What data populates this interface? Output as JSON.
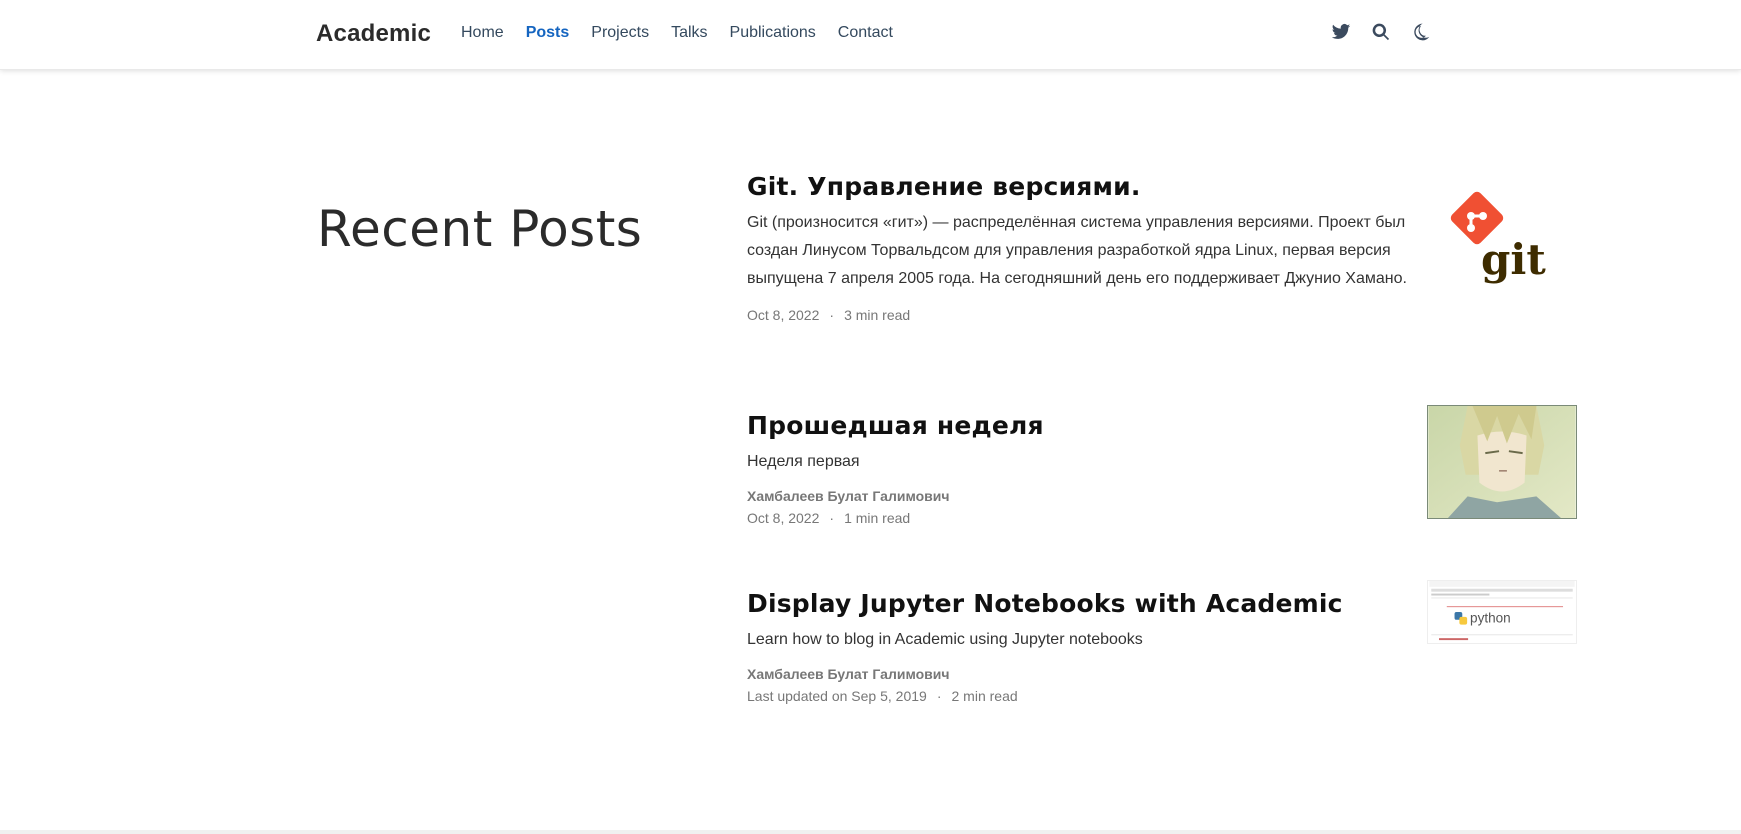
{
  "header": {
    "brand": "Academic",
    "nav": [
      "Home",
      "Posts",
      "Projects",
      "Talks",
      "Publications",
      "Contact"
    ],
    "active": "Posts",
    "icons": [
      "twitter-icon",
      "search-icon",
      "moon-icon"
    ]
  },
  "main": {
    "section_title": "Recent Posts",
    "posts": [
      {
        "title": "Git. Управление версиями.",
        "summary": "Git (произносится «гит») — распределённая система управления версиями. Проект был создан Линусом Торвальдсом для управления разработкой ядра Linux, первая версия выпущена 7 апреля 2005 года. На сегодняшний день его поддерживает Джунио Хамано.",
        "author": "",
        "date": "Oct 8, 2022",
        "read_time": "3 min read",
        "thumb_text": "git"
      },
      {
        "title": "Прошедшая неделя",
        "summary": "Неделя первая",
        "author": "Хамбалеев Булат Галимович",
        "date": "Oct 8, 2022",
        "read_time": "1 min read"
      },
      {
        "title": "Display Jupyter Notebooks with Academic",
        "summary": "Learn how to blog in Academic using Jupyter notebooks",
        "author": "Хамбалеев Булат Галимович",
        "date": "Last updated on Sep 5, 2019",
        "read_time": "2 min read",
        "thumb_text": "python"
      }
    ]
  },
  "colors": {
    "accent": "#1565c0",
    "git_orange": "#f05033",
    "git_dark": "#3e2c00"
  }
}
